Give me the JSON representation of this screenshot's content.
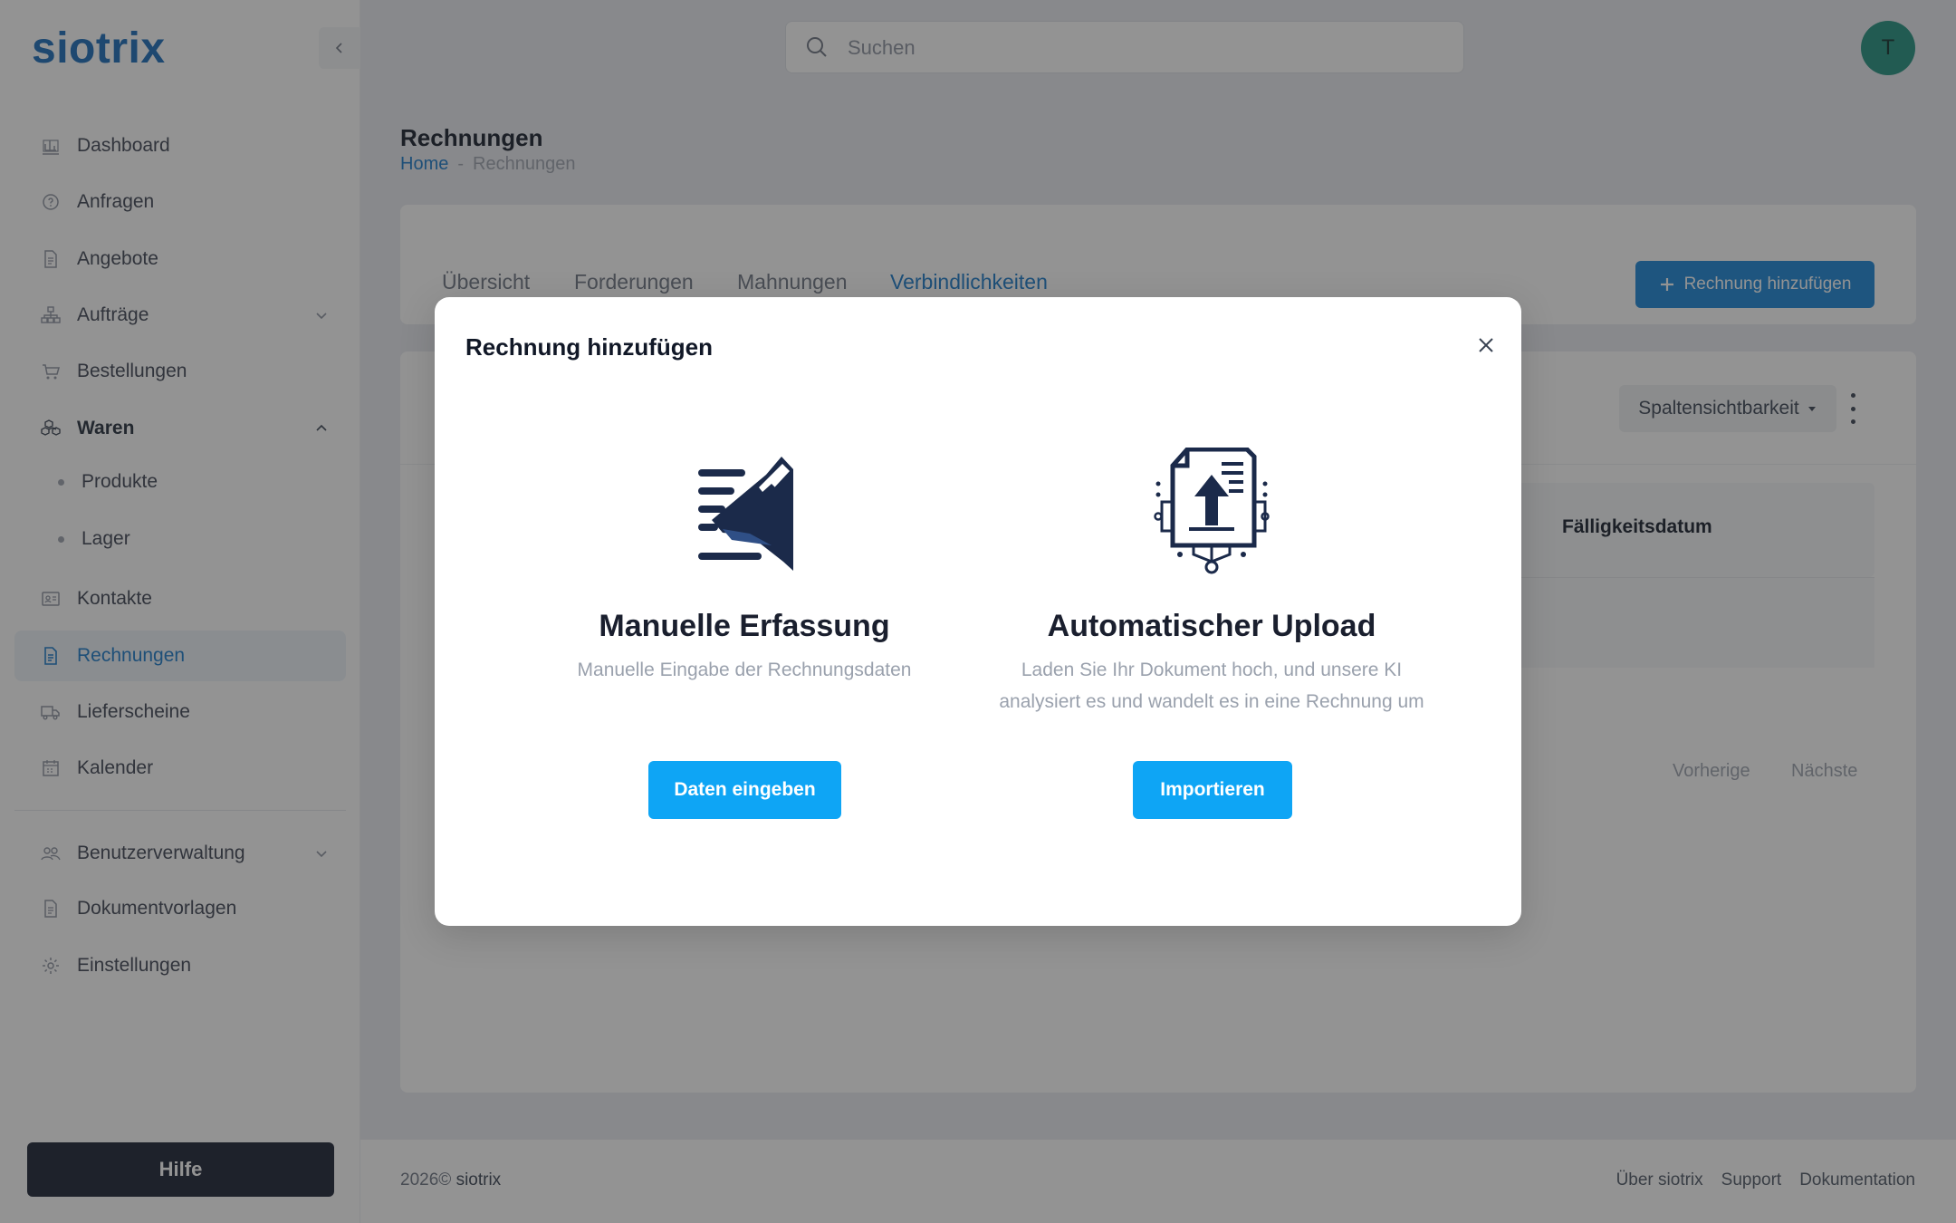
{
  "app": {
    "logo": "siotrix",
    "avatar_initial": "T"
  },
  "search": {
    "placeholder": "Suchen"
  },
  "sidebar": {
    "items": [
      {
        "label": "Dashboard",
        "icon": "bar-chart-icon"
      },
      {
        "label": "Anfragen",
        "icon": "question-circle-icon"
      },
      {
        "label": "Angebote",
        "icon": "document-icon"
      },
      {
        "label": "Aufträge",
        "icon": "org-chart-icon"
      },
      {
        "label": "Bestellungen",
        "icon": "cart-icon"
      },
      {
        "label": "Waren",
        "icon": "boxes-icon"
      },
      {
        "label": "Produkte"
      },
      {
        "label": "Lager"
      },
      {
        "label": "Kontakte",
        "icon": "id-card-icon"
      },
      {
        "label": "Rechnungen",
        "icon": "invoice-icon"
      },
      {
        "label": "Lieferscheine",
        "icon": "truck-icon"
      },
      {
        "label": "Kalender",
        "icon": "calendar-icon"
      },
      {
        "label": "Benutzerverwaltung",
        "icon": "users-icon"
      },
      {
        "label": "Dokumentvorlagen",
        "icon": "document-icon"
      },
      {
        "label": "Einstellungen",
        "icon": "gear-icon"
      }
    ],
    "help_label": "Hilfe"
  },
  "page": {
    "title": "Rechnungen",
    "breadcrumb": {
      "home": "Home",
      "sep": "-",
      "current": "Rechnungen"
    }
  },
  "tabs": [
    "Übersicht",
    "Forderungen",
    "Mahnungen",
    "Verbindlichkeiten"
  ],
  "toolbar": {
    "add_label": "Rechnung hinzufügen",
    "columns_label": "Spaltensichtbarkeit"
  },
  "table": {
    "col_due": "Fälligkeitsdatum"
  },
  "pager": {
    "prev": "Vorherige",
    "next": "Nächste"
  },
  "footer": {
    "year": "2026©",
    "brand": "siotrix",
    "links": [
      "Über siotrix",
      "Support",
      "Dokumentation"
    ]
  },
  "modal": {
    "title": "Rechnung hinzufügen",
    "manual": {
      "title": "Manuelle Erfassung",
      "desc": "Manuelle Eingabe der Rechnungsdaten",
      "button": "Daten eingeben"
    },
    "upload": {
      "title": "Automatischer Upload",
      "desc_line1": "Laden Sie Ihr Dokument hoch, und unsere KI",
      "desc_line2": "analysiert es und wandelt es in eine Rechnung um",
      "button": "Importieren"
    }
  },
  "colors": {
    "accent": "#1477c9",
    "primary_button": "#0ea5f5",
    "help_button": "#151c2e",
    "avatar": "#1c8f7c"
  }
}
